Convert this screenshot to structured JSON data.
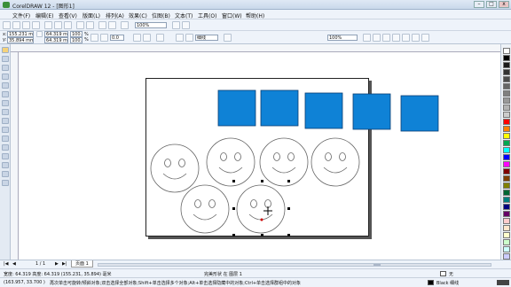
{
  "window": {
    "title": "CorelDRAW 12 - [图形1]",
    "min": "–",
    "max": "□",
    "close": "x"
  },
  "menus": [
    "文件(F)",
    "编辑(E)",
    "查看(V)",
    "版面(L)",
    "排列(A)",
    "效果(C)",
    "位图(B)",
    "文本(T)",
    "工具(O)",
    "窗口(W)",
    "帮助(H)"
  ],
  "standard_bar": {
    "zoom_value": "100%"
  },
  "property_bar": {
    "x_label": "x:",
    "x_value": "155.231 mm",
    "y_label": "y:",
    "y_value": "35.894 mm",
    "w_value": "64.319 mm",
    "h_value": "64.319 mm",
    "scale_w": "100.0",
    "scale_h": "100.0",
    "percent": "%",
    "angle": "0.0",
    "outline_label": "细线",
    "zoom_value": "100%"
  },
  "page_nav": {
    "first": "|◀",
    "prev": "◀",
    "counter": "1 / 1",
    "next": "▶",
    "last": "▶|",
    "page_tab": "页面 1"
  },
  "status": {
    "dims": "宽度: 64.319  高度: 64.319 (155.231, 35.894)  毫米",
    "selection": "完美形状 在 图层 1",
    "cursor": "(163.957, 33.700 )",
    "hint": "再次单击可旋转/倾斜对象;双击选择全部对象;Shift+单击选择多个对象;Alt+单击选择隐藏中的对象;Ctrl+单击选择群组中的对象",
    "fill_label": "无",
    "outline_label": "Black  细线"
  },
  "colors": {
    "square_fill": "#0f82d6",
    "square_stroke": "#0b3e73",
    "face_stroke": "#666666",
    "palette": [
      "#ffffff",
      "#000000",
      "#1a1a1a",
      "#333333",
      "#4d4d4d",
      "#666666",
      "#808080",
      "#999999",
      "#b3b3b3",
      "#cccccc",
      "#ff0000",
      "#ff8000",
      "#ffff00",
      "#00a651",
      "#00ffff",
      "#0000ff",
      "#ff00ff",
      "#800000",
      "#804000",
      "#808000",
      "#006633",
      "#008080",
      "#000080",
      "#660066",
      "#ffcccc",
      "#ffe6cc",
      "#ffffcc",
      "#ccffcc",
      "#ccffff",
      "#ccccff"
    ]
  }
}
